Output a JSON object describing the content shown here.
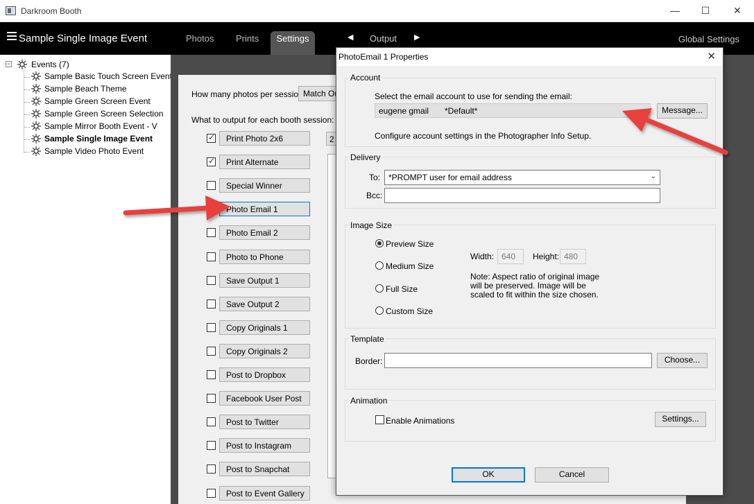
{
  "window": {
    "title": "Darkroom Booth",
    "minimize_icon": "minimize-icon",
    "maximize_icon": "maximize-icon",
    "close_icon": "close-icon"
  },
  "appbar": {
    "event_title": "Sample Single Image Event",
    "tabs": [
      "Photos",
      "Prints",
      "Settings"
    ],
    "output_label": "Output",
    "global_settings": "Global Settings"
  },
  "tree": {
    "root_label": "Events (7)",
    "toggle": "−",
    "items": [
      "Sample Basic Touch Screen Event",
      "Sample Beach Theme",
      "Sample Green Screen Event",
      "Sample Green Screen Selection",
      "Sample Mirror Booth Event - V",
      "Sample Single Image Event",
      "Sample Video Photo Event"
    ],
    "selected": "Sample Single Image Event"
  },
  "settings_panel": {
    "photos_per_session_label": "How many photos per session:",
    "photos_per_session_value": "Match Ou",
    "output_label": "What to output for each booth session:",
    "side_value": "2",
    "outputs": [
      {
        "label": "Print Photo  2x6",
        "checked": true
      },
      {
        "label": "Print Alternate",
        "checked": true
      },
      {
        "label": "Special Winner",
        "checked": false
      },
      {
        "label": "Photo Email 1",
        "checked": false
      },
      {
        "label": "Photo Email 2",
        "checked": false
      },
      {
        "label": "Photo to Phone",
        "checked": false
      },
      {
        "label": "Save Output 1",
        "checked": false
      },
      {
        "label": "Save Output 2",
        "checked": false
      },
      {
        "label": "Copy Originals 1",
        "checked": false
      },
      {
        "label": "Copy Originals 2",
        "checked": false
      },
      {
        "label": "Post to Dropbox",
        "checked": false
      },
      {
        "label": "Facebook User Post",
        "checked": false
      },
      {
        "label": "Post to Twitter",
        "checked": false
      },
      {
        "label": "Post to Instagram",
        "checked": false
      },
      {
        "label": "Post to Snapchat",
        "checked": false
      },
      {
        "label": "Post to Event Gallery",
        "checked": false
      }
    ]
  },
  "dialog": {
    "title": "PhotoEmail 1 Properties",
    "account": {
      "group_label": "Account",
      "instruction": "Select the email account to use for sending the email:",
      "account_name": "eugene gmail",
      "account_default": "*Default*",
      "message_button": "Message...",
      "configure_note": "Configure account settings in the Photographer Info Setup."
    },
    "delivery": {
      "group_label": "Delivery",
      "to_label": "To:",
      "to_value": "*PROMPT user for email address",
      "bcc_label": "Bcc:",
      "bcc_value": ""
    },
    "image_size": {
      "group_label": "Image Size",
      "options": [
        "Preview Size",
        "Medium Size",
        "Full Size",
        "Custom Size"
      ],
      "selected": "Preview Size",
      "width_label": "Width:",
      "width_value": "640",
      "height_label": "Height:",
      "height_value": "480",
      "note_line1": "Note: Aspect ratio of original image",
      "note_line2": "will be preserved. Image will be",
      "note_line3": "scaled to fit within the size chosen."
    },
    "template": {
      "group_label": "Template",
      "border_label": "Border:",
      "border_value": "",
      "choose_button": "Choose..."
    },
    "animation": {
      "group_label": "Animation",
      "enable_label": "Enable Animations",
      "enabled": false,
      "settings_button": "Settings..."
    },
    "ok_button": "OK",
    "cancel_button": "Cancel"
  },
  "colors": {
    "annotation_arrow": "#e8403c",
    "appbar_bg": "#000000",
    "focus_blue": "#0078d7"
  }
}
